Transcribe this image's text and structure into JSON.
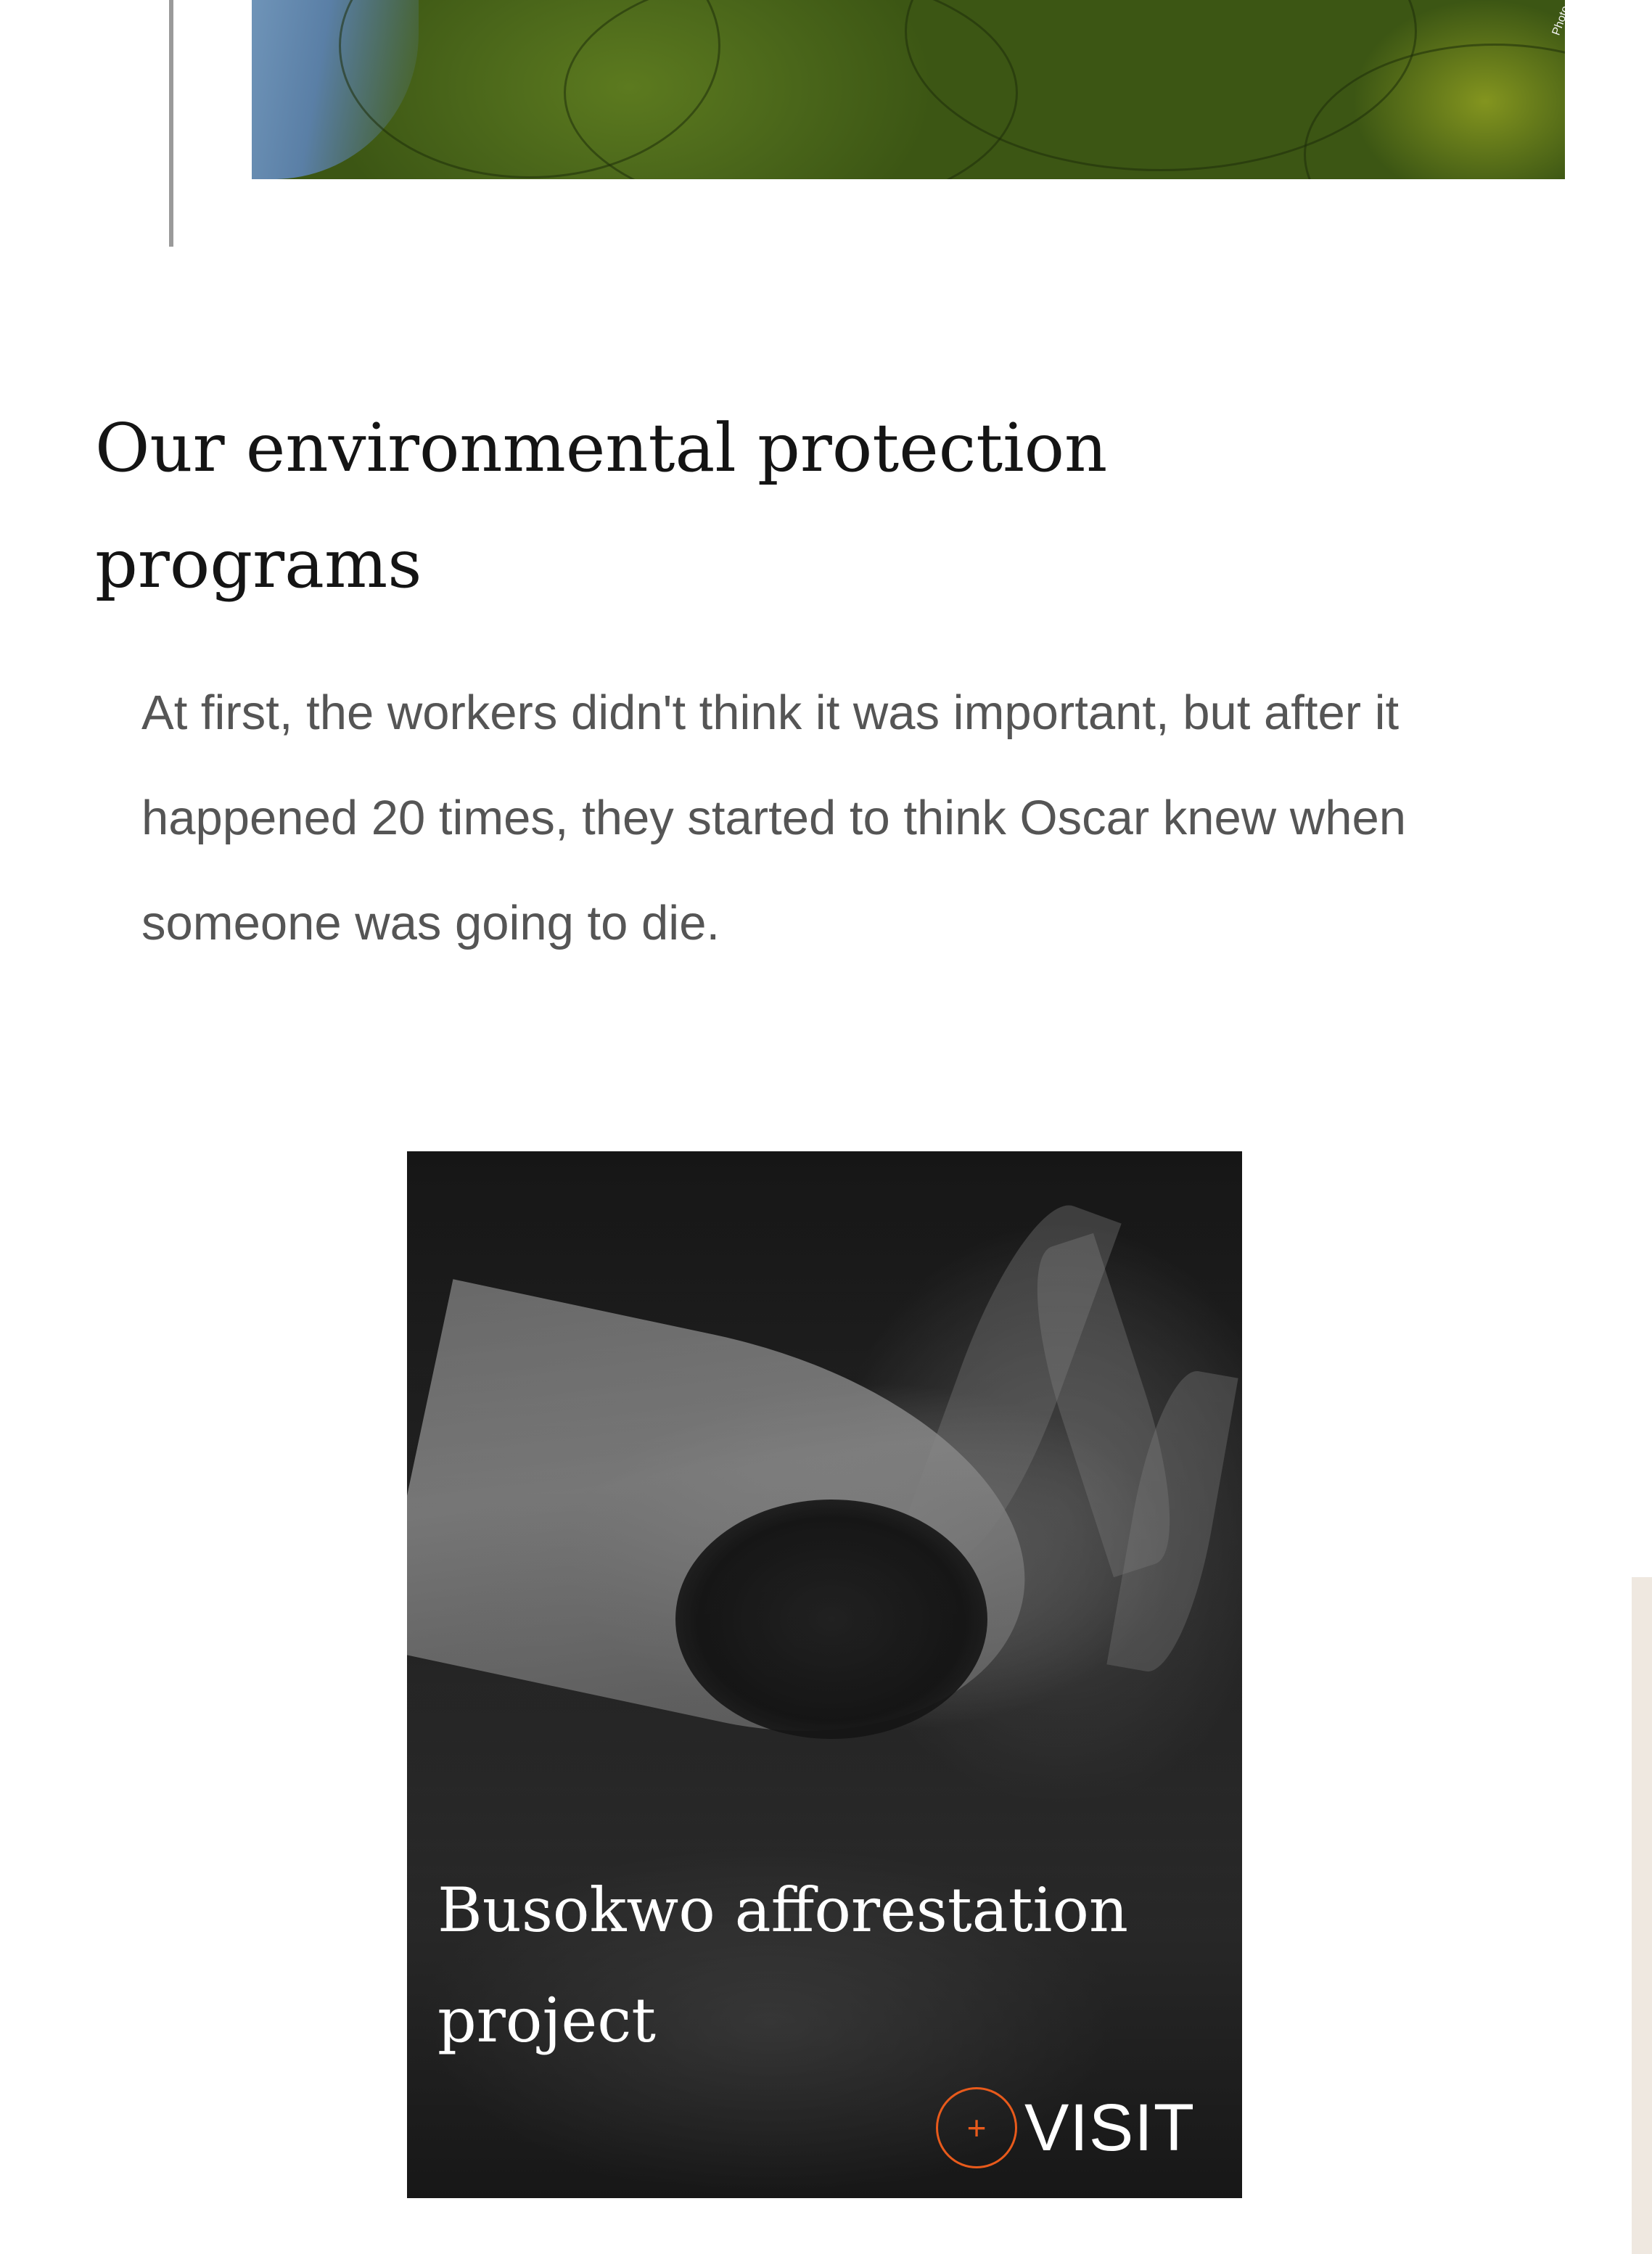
{
  "top_photo": {
    "alt": "lily pads on water",
    "credit": "Photo"
  },
  "section": {
    "title": "Our environmental protection programs",
    "body": "At first, the workers didn't think it was important, but after it happened 20 times, they started to think Oscar knew when someone was going to die."
  },
  "program_card": {
    "title": "Busokwo afforestation project",
    "visit_label": "VISIT",
    "visit_icon": "plus-circle-icon",
    "accent_color": "#e85a1b"
  },
  "colors": {
    "title_text": "#141414",
    "body_text": "#555555",
    "accent_line": "#9a9a9a",
    "side_strip": "#efe8e0"
  }
}
